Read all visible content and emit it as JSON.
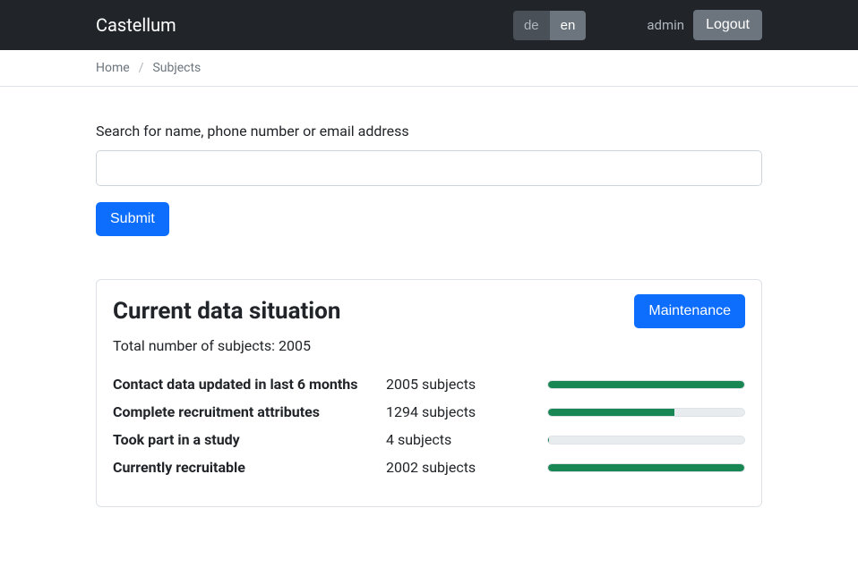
{
  "navbar": {
    "brand": "Castellum",
    "lang_de": "de",
    "lang_en": "en",
    "user": "admin",
    "logout": "Logout"
  },
  "breadcrumb": {
    "home": "Home",
    "subjects": "Subjects"
  },
  "search": {
    "label": "Search for name, phone number or email address",
    "submit": "Submit"
  },
  "card": {
    "title": "Current data situation",
    "maintenance": "Maintenance",
    "total_label": "Total number of subjects: 2005",
    "total": 2005,
    "stats": [
      {
        "label": "Contact data updated in last 6 months",
        "value_text": "2005 subjects",
        "value": 2005,
        "pct": 100
      },
      {
        "label": "Complete recruitment attributes",
        "value_text": "1294 subjects",
        "value": 1294,
        "pct": 64.5
      },
      {
        "label": "Took part in a study",
        "value_text": "4 subjects",
        "value": 4,
        "pct": 0.2
      },
      {
        "label": "Currently recruitable",
        "value_text": "2002 subjects",
        "value": 2002,
        "pct": 99.85
      }
    ]
  }
}
